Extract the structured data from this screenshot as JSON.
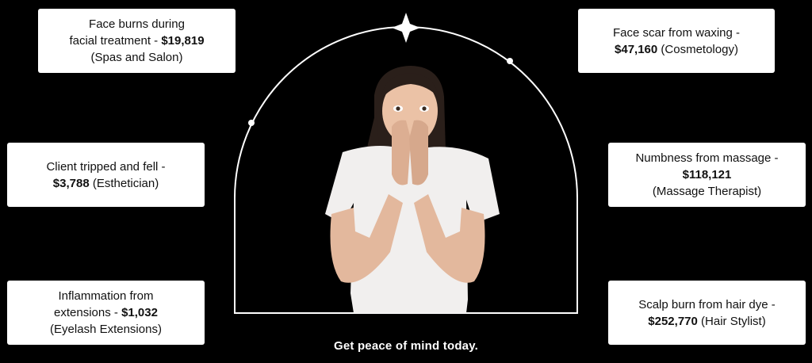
{
  "cards": [
    {
      "line1": "Face burns during",
      "line2a": "facial treatment - ",
      "amount": "$19,819",
      "line3": "(Spas and Salon)"
    },
    {
      "line1": "Face scar from waxing -",
      "amount": "$47,160",
      "line2b": " (Cosmetology)"
    },
    {
      "line1": "Client tripped and fell -",
      "amount": "$3,788",
      "line2b": " (Esthetician)"
    },
    {
      "line1": "Numbness from massage -",
      "amount": "$118,121",
      "line3": "(Massage Therapist)"
    },
    {
      "line1": "Inflammation from",
      "line2a": "extensions - ",
      "amount": "$1,032",
      "line3": "(Eyelash Extensions)"
    },
    {
      "line1": "Scalp burn from hair dye -",
      "amount": "$252,770",
      "line2b": " (Hair Stylist)"
    }
  ],
  "footer": "Get peace of mind today.",
  "colors": {
    "background": "#000000",
    "card": "#ffffff",
    "arch": "#ffffff"
  }
}
